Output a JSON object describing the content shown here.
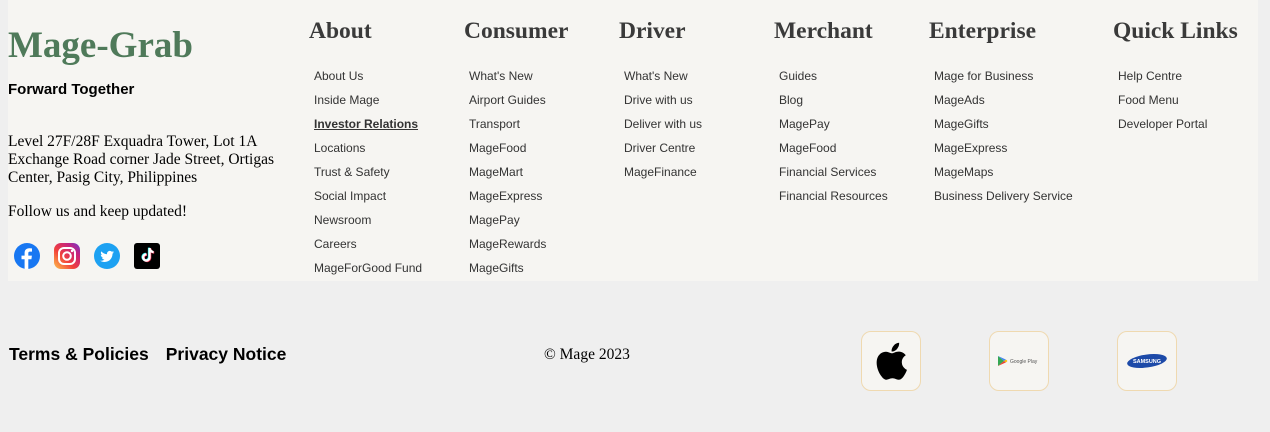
{
  "brand": {
    "name": "Mage-Grab",
    "tagline": "Forward Together",
    "address": "Level 27F/28F Exquadra Tower, Lot 1A Exchange Road corner Jade Street, Ortigas Center, Pasig City, Philippines",
    "follow_text": "Follow us and keep updated!",
    "socials": [
      {
        "icon": "facebook-icon"
      },
      {
        "icon": "instagram-icon"
      },
      {
        "icon": "twitter-icon"
      },
      {
        "icon": "tiktok-icon"
      }
    ]
  },
  "columns": [
    {
      "title": "About",
      "items": [
        "About Us",
        "Inside Mage",
        "Investor Relations",
        "Locations",
        "Trust & Safety",
        "Social Impact",
        "Newsroom",
        "Careers",
        "MageForGood Fund"
      ],
      "active": "Investor Relations"
    },
    {
      "title": "Consumer",
      "items": [
        "What's New",
        "Airport Guides",
        "Transport",
        "MageFood",
        "MageMart",
        "MageExpress",
        "MagePay",
        "MageRewards",
        "MageGifts"
      ]
    },
    {
      "title": "Driver",
      "items": [
        "What's New",
        "Drive with us",
        "Deliver with us",
        "Driver Centre",
        "MageFinance"
      ]
    },
    {
      "title": "Merchant",
      "items": [
        "Guides",
        "Blog",
        "MagePay",
        "MageFood",
        "Financial Services",
        "Financial Resources"
      ]
    },
    {
      "title": "Enterprise",
      "items": [
        "Mage for Business",
        "MageAds",
        "MageGifts",
        "MageExpress",
        "MageMaps",
        "Business Delivery Service"
      ]
    },
    {
      "title": "Quick Links",
      "items": [
        "Help Centre",
        "Food Menu",
        "Developer Portal"
      ]
    }
  ],
  "bottom": {
    "terms": "Terms & Policies",
    "privacy": "Privacy Notice",
    "copyright": "© Mage 2023",
    "stores": [
      {
        "icon": "apple-app-store-icon"
      },
      {
        "icon": "google-play-icon",
        "label": "Google Play"
      },
      {
        "icon": "samsung-store-icon",
        "label": "SAMSUNG"
      }
    ]
  },
  "colors": {
    "brand_green": "#4f7a5a",
    "footer_bg": "#f6f5f2",
    "page_bg": "#efefef",
    "store_border": "#efd9b0"
  }
}
